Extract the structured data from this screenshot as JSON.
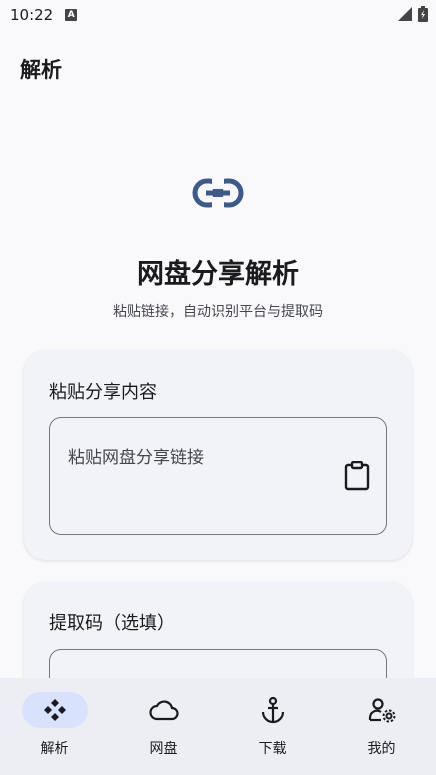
{
  "status": {
    "time": "10:22",
    "notif": "A"
  },
  "app": {
    "title": "解析"
  },
  "hero": {
    "icon": "link-icon",
    "title": "网盘分享解析",
    "subtitle": "粘贴链接，自动识别平台与提取码"
  },
  "share_card": {
    "title": "粘贴分享内容",
    "placeholder": "粘贴网盘分享链接",
    "paste_icon": "clipboard-icon"
  },
  "code_card": {
    "title": "提取码（选填）"
  },
  "nav": {
    "items": [
      {
        "label": "解析",
        "icon": "parse-diamond-icon",
        "active": true
      },
      {
        "label": "网盘",
        "icon": "cloud-icon",
        "active": false
      },
      {
        "label": "下载",
        "icon": "anchor-icon",
        "active": false
      },
      {
        "label": "我的",
        "icon": "person-settings-icon",
        "active": false
      }
    ]
  },
  "colors": {
    "accent": "#3c5a8c",
    "background": "#f9f9fc",
    "card": "#f1f3f8",
    "nav_active": "#d9e2fc"
  }
}
